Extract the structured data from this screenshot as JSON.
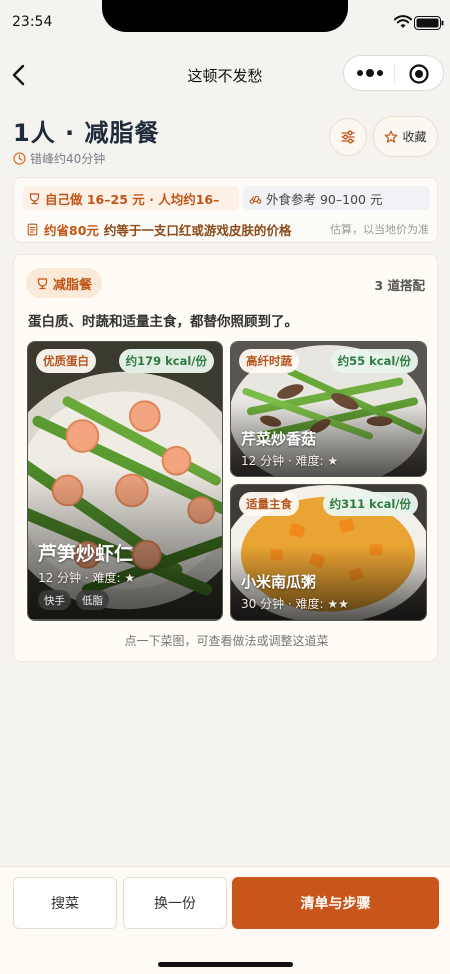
{
  "status": {
    "time": "23:54"
  },
  "nav": {
    "title": "这顿不发愁"
  },
  "header": {
    "title": "1人 · 减脂餐",
    "time_note": "错峰约40分钟",
    "favorite_label": "收藏"
  },
  "cost": {
    "self_cook": "自己做 16–25 元 · 人均约16–",
    "takeout": "外食参考 90–100 元",
    "save_amount": "约省80元",
    "save_desc": "约等于一支口红或游戏皮肤的价格",
    "estimate_note": "估算，以当地价为准"
  },
  "meal": {
    "tag": "减脂餐",
    "count": "3 道搭配",
    "description": "蛋白质、时蔬和适量主食，都替你照顾到了。",
    "dishes": [
      {
        "label": "优质蛋白",
        "kcal": "约179 kcal/份",
        "name": "芦笋炒虾仁",
        "meta": "12 分钟 · 难度: ★",
        "tags": [
          "快手",
          "低脂"
        ]
      },
      {
        "label": "高纤时蔬",
        "kcal": "约55 kcal/份",
        "name": "芹菜炒香菇",
        "meta": "12 分钟 · 难度: ★"
      },
      {
        "label": "适量主食",
        "kcal": "约311 kcal/份",
        "name": "小米南瓜粥",
        "meta": "30 分钟 · 难度: ★★"
      }
    ],
    "hint": "点一下菜图，可查看做法或调整这道菜"
  },
  "actions": {
    "search": "搜菜",
    "swap": "换一份",
    "primary": "清单与步骤"
  },
  "colors": {
    "accent": "#c8561a",
    "accent_text": "#c25416",
    "kcal_green": "#2f7a42",
    "background": "#f5f3ef"
  },
  "icons": [
    "wifi-icon",
    "battery-icon",
    "back-icon",
    "more-icon",
    "close-circle-icon",
    "clock-icon",
    "filter-icon",
    "star-icon",
    "cup-icon",
    "car-icon",
    "document-icon"
  ]
}
